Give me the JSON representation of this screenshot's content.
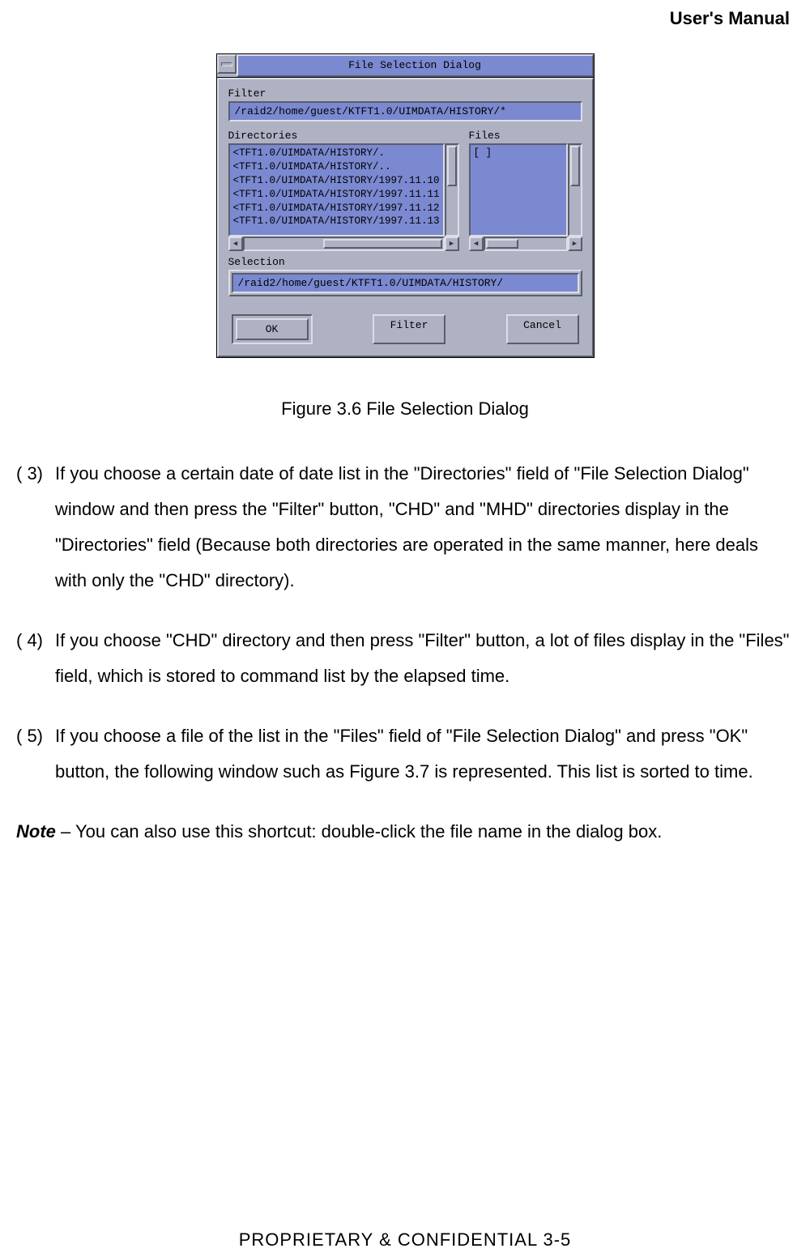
{
  "header": {
    "title": "User's Manual"
  },
  "dialog": {
    "title": "File Selection Dialog",
    "filter_label": "Filter",
    "filter_value": "/raid2/home/guest/KTFT1.0/UIMDATA/HISTORY/*",
    "directories_label": "Directories",
    "files_label": "Files",
    "directories": [
      "<TFT1.0/UIMDATA/HISTORY/.",
      "<TFT1.0/UIMDATA/HISTORY/..",
      "<TFT1.0/UIMDATA/HISTORY/1997.11.10",
      "<TFT1.0/UIMDATA/HISTORY/1997.11.11",
      "<TFT1.0/UIMDATA/HISTORY/1997.11.12",
      "<TFT1.0/UIMDATA/HISTORY/1997.11.13"
    ],
    "files": [
      "[    ]"
    ],
    "selection_label": "Selection",
    "selection_value": "/raid2/home/guest/KTFT1.0/UIMDATA/HISTORY/",
    "buttons": {
      "ok": "OK",
      "filter": "Filter",
      "cancel": "Cancel"
    }
  },
  "figure_caption": "Figure 3.6 File Selection Dialog",
  "paragraphs": {
    "p3_num": "( 3)",
    "p3_text": "If you choose a certain date of date list in the \"Directories\" field of \"File Selection Dialog\" window and then press the \"Filter\" button, \"CHD\" and \"MHD\" directories display in the \"Directories\" field (Because both directories are operated in the same manner, here deals with only the \"CHD\" directory).",
    "p4_num": "( 4)",
    "p4_text": "If you choose \"CHD\" directory and then press \"Filter\" button, a lot of files display in the \"Files\" field, which is stored to command list by the elapsed time.",
    "p5_num": "( 5)",
    "p5_text": "If you choose a file of the list in the \"Files\" field of \"File Selection Dialog\" and press \"OK\" button, the following window such as Figure 3.7 is represented. This list is sorted to time."
  },
  "note": {
    "label": "Note",
    "text": " – You can also use this shortcut: double-click the file name in the dialog box."
  },
  "footer": "PROPRIETARY & CONFIDENTIAL                3-5"
}
